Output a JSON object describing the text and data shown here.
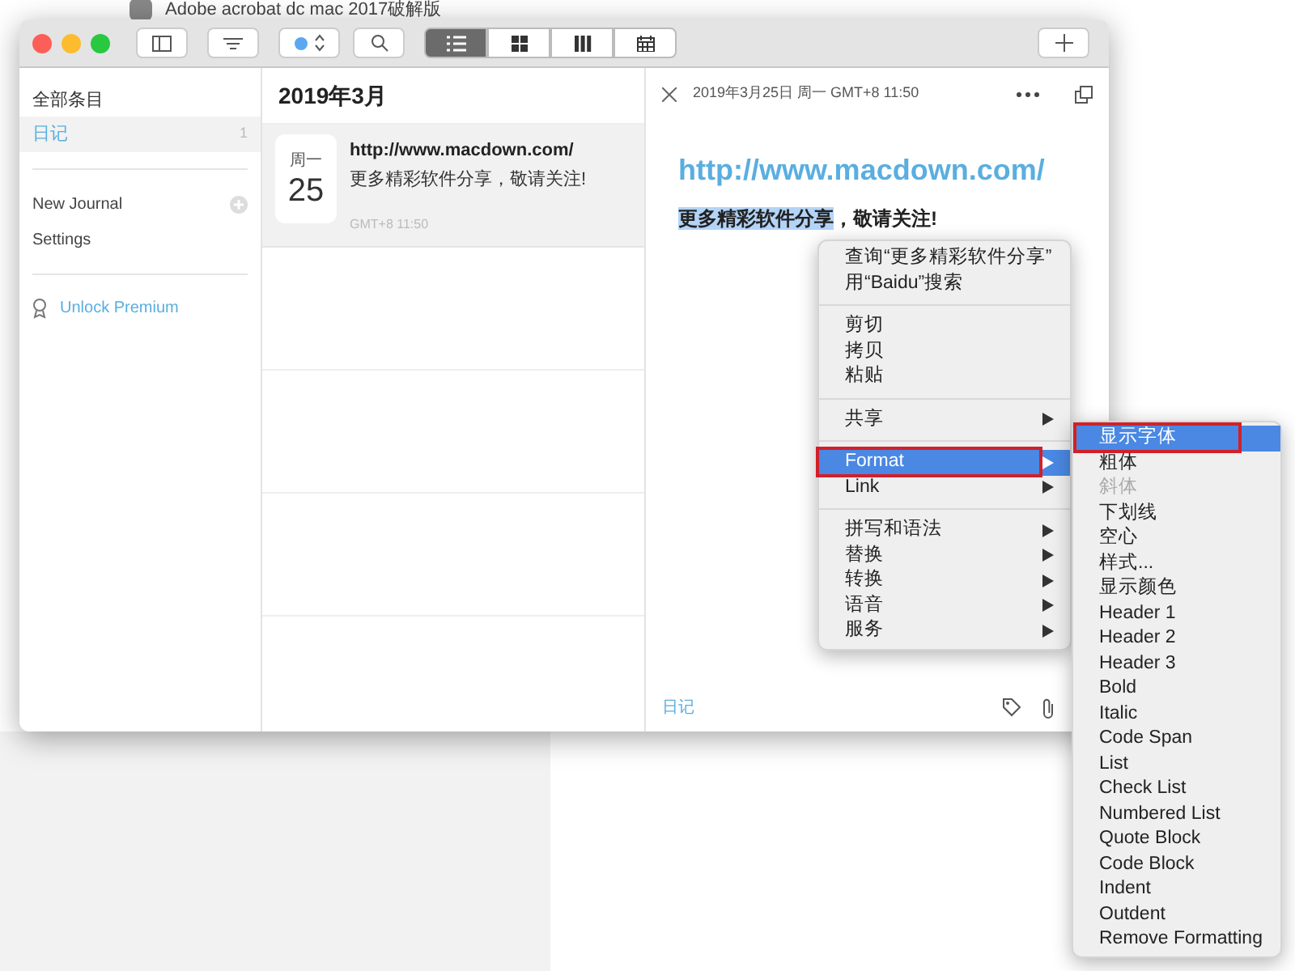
{
  "background_title": "Adobe acrobat dc mac 2017破解版",
  "toolbar": {
    "view_modes": [
      {
        "kind": "list",
        "selected": true
      },
      {
        "kind": "grid",
        "selected": false
      },
      {
        "kind": "columns",
        "selected": false
      },
      {
        "kind": "calendar",
        "selected": false
      }
    ]
  },
  "sidebar": {
    "heading": "全部条目",
    "items": [
      {
        "label": "日记",
        "count": "1",
        "selected": true
      }
    ],
    "links": [
      {
        "label": "New Journal",
        "kind": "add"
      },
      {
        "label": "Settings",
        "kind": "plain"
      }
    ],
    "premium": "Unlock Premium"
  },
  "list": {
    "title": "2019年3月",
    "entries": [
      {
        "weekday": "周一",
        "day": "25",
        "title": "http://www.macdown.com/",
        "text": "更多精彩软件分享，敬请关注!",
        "time": "GMT+8 11:50",
        "selected": true
      }
    ]
  },
  "editor": {
    "date": "2019年3月25日 周一 GMT+8 11:50",
    "heading": "http://www.macdown.com/",
    "body_selected": "更多精彩软件分享",
    "body_rest": "，敬请关注!",
    "journal": "日记"
  },
  "context_menu": {
    "groups": [
      [
        {
          "label": "查询“更多精彩软件分享”",
          "submenu": false,
          "selected": false,
          "highlighted": false
        },
        {
          "label": "用“Baidu”搜索",
          "submenu": false,
          "selected": false,
          "highlighted": false
        }
      ],
      [
        {
          "label": "剪切",
          "submenu": false,
          "selected": false,
          "highlighted": false
        },
        {
          "label": "拷贝",
          "submenu": false,
          "selected": false,
          "highlighted": false
        },
        {
          "label": "粘贴",
          "submenu": false,
          "selected": false,
          "highlighted": false
        }
      ],
      [
        {
          "label": "共享",
          "submenu": true,
          "selected": false,
          "highlighted": false
        }
      ],
      [
        {
          "label": "Format",
          "submenu": true,
          "selected": true,
          "highlighted": true
        },
        {
          "label": "Link",
          "submenu": true,
          "selected": false,
          "highlighted": false
        }
      ],
      [
        {
          "label": "拼写和语法",
          "submenu": true,
          "selected": false,
          "highlighted": false
        },
        {
          "label": "替换",
          "submenu": true,
          "selected": false,
          "highlighted": false
        },
        {
          "label": "转换",
          "submenu": true,
          "selected": false,
          "highlighted": false
        },
        {
          "label": "语音",
          "submenu": true,
          "selected": false,
          "highlighted": false
        },
        {
          "label": "服务",
          "submenu": true,
          "selected": false,
          "highlighted": false
        }
      ]
    ]
  },
  "submenu": {
    "items": [
      {
        "label": "显示字体",
        "selected": true,
        "disabled": false,
        "highlighted": true
      },
      {
        "label": "粗体",
        "selected": false,
        "disabled": false,
        "highlighted": false
      },
      {
        "label": "斜体",
        "selected": false,
        "disabled": true,
        "highlighted": false
      },
      {
        "label": "下划线",
        "selected": false,
        "disabled": false,
        "highlighted": false
      },
      {
        "label": "空心",
        "selected": false,
        "disabled": false,
        "highlighted": false
      },
      {
        "label": "样式...",
        "selected": false,
        "disabled": false,
        "highlighted": false
      },
      {
        "label": "显示颜色",
        "selected": false,
        "disabled": false,
        "highlighted": false
      },
      {
        "label": "Header 1",
        "selected": false,
        "disabled": false,
        "highlighted": false
      },
      {
        "label": "Header 2",
        "selected": false,
        "disabled": false,
        "highlighted": false
      },
      {
        "label": "Header 3",
        "selected": false,
        "disabled": false,
        "highlighted": false
      },
      {
        "label": "Bold",
        "selected": false,
        "disabled": false,
        "highlighted": false
      },
      {
        "label": "Italic",
        "selected": false,
        "disabled": false,
        "highlighted": false
      },
      {
        "label": "Code Span",
        "selected": false,
        "disabled": false,
        "highlighted": false
      },
      {
        "label": "List",
        "selected": false,
        "disabled": false,
        "highlighted": false
      },
      {
        "label": "Check List",
        "selected": false,
        "disabled": false,
        "highlighted": false
      },
      {
        "label": "Numbered List",
        "selected": false,
        "disabled": false,
        "highlighted": false
      },
      {
        "label": "Quote Block",
        "selected": false,
        "disabled": false,
        "highlighted": false
      },
      {
        "label": "Code Block",
        "selected": false,
        "disabled": false,
        "highlighted": false
      },
      {
        "label": "Indent",
        "selected": false,
        "disabled": false,
        "highlighted": false
      },
      {
        "label": "Outdent",
        "selected": false,
        "disabled": false,
        "highlighted": false
      },
      {
        "label": "Remove Formatting",
        "selected": false,
        "disabled": false,
        "highlighted": false
      }
    ]
  }
}
